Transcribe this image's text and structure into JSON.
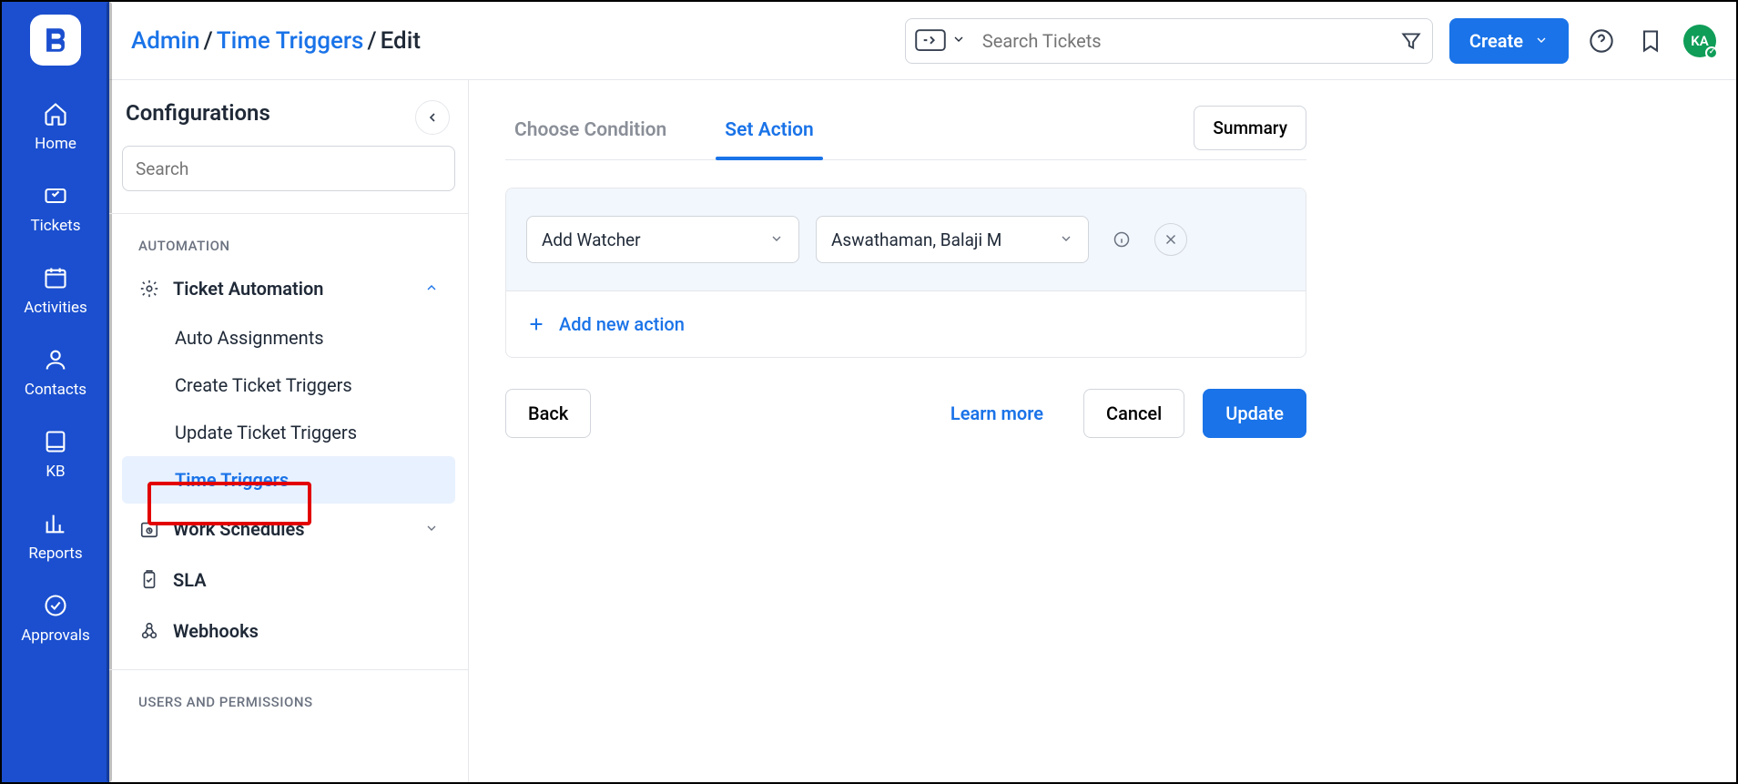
{
  "rail": [
    {
      "key": "home",
      "label": "Home"
    },
    {
      "key": "tickets",
      "label": "Tickets"
    },
    {
      "key": "activities",
      "label": "Activities"
    },
    {
      "key": "contacts",
      "label": "Contacts"
    },
    {
      "key": "kb",
      "label": "KB"
    },
    {
      "key": "reports",
      "label": "Reports"
    },
    {
      "key": "approvals",
      "label": "Approvals"
    }
  ],
  "breadcrumb": {
    "admin": "Admin",
    "module": "Time Triggers",
    "current": "Edit"
  },
  "search": {
    "placeholder": "Search Tickets"
  },
  "header": {
    "create": "Create",
    "avatar": "KA"
  },
  "sidebar": {
    "title": "Configurations",
    "search_placeholder": "Search",
    "section_automation": "AUTOMATION",
    "ticket_automation": "Ticket Automation",
    "children": [
      "Auto Assignments",
      "Create Ticket Triggers",
      "Update Ticket Triggers",
      "Time Triggers"
    ],
    "work_schedules": "Work Schedules",
    "sla": "SLA",
    "webhooks": "Webhooks",
    "section_users": "USERS AND PERMISSIONS"
  },
  "tabs": {
    "condition": "Choose Condition",
    "action": "Set Action",
    "summary": "Summary"
  },
  "action": {
    "type": "Add Watcher",
    "value": "Aswathaman, Balaji M",
    "add": "Add new action"
  },
  "footer": {
    "back": "Back",
    "learn": "Learn more",
    "cancel": "Cancel",
    "update": "Update"
  }
}
